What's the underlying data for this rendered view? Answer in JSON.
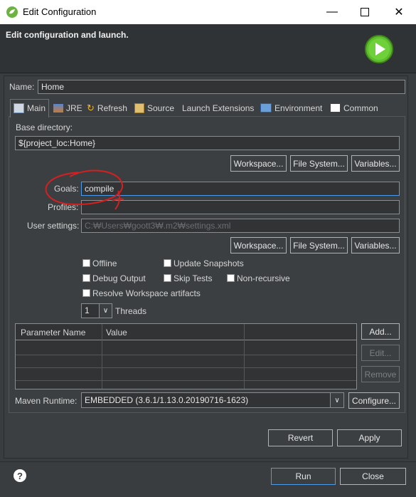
{
  "window": {
    "title": "Edit Configuration"
  },
  "header": {
    "title": "Edit configuration and launch."
  },
  "name": {
    "label": "Name:",
    "value": "Home"
  },
  "tabs": [
    {
      "label": "Main",
      "icon": "main-tab-icon"
    },
    {
      "label": "JRE",
      "icon": "jre-icon"
    },
    {
      "label": "Refresh",
      "icon": "refresh-icon"
    },
    {
      "label": "Source",
      "icon": "source-icon"
    },
    {
      "label": "Launch Extensions",
      "icon": ""
    },
    {
      "label": "Environment",
      "icon": "environment-icon"
    },
    {
      "label": "Common",
      "icon": "common-icon"
    }
  ],
  "base": {
    "label": "Base directory:",
    "value": "${project_loc:Home}"
  },
  "buttons1": {
    "workspace": "Workspace...",
    "filesystem": "File System...",
    "variables": "Variables..."
  },
  "goals": {
    "label": "Goals:",
    "value": "compile"
  },
  "profiles": {
    "label": "Profiles:",
    "value": ""
  },
  "user_settings": {
    "label": "User settings:",
    "value": "C:₩Users₩goott3₩.m2₩settings.xml"
  },
  "buttons2": {
    "workspace": "Workspace...",
    "filesystem": "File System...",
    "variables": "Variables..."
  },
  "options": {
    "offline": "Offline",
    "update_snapshots": "Update Snapshots",
    "debug_output": "Debug Output",
    "skip_tests": "Skip Tests",
    "non_recursive": "Non-recursive",
    "resolve_workspace": "Resolve Workspace artifacts"
  },
  "threads": {
    "value": "1",
    "label": "Threads"
  },
  "param_table": {
    "headers": [
      "Parameter Name",
      "Value",
      ""
    ]
  },
  "param_buttons": {
    "add": "Add...",
    "edit": "Edit...",
    "remove": "Remove"
  },
  "runtime": {
    "label": "Maven Runtime:",
    "value": "EMBEDDED (3.6.1/1.13.0.20190716-1623)",
    "configure": "Configure..."
  },
  "actions": {
    "revert": "Revert",
    "apply": "Apply"
  },
  "footer": {
    "help": "?",
    "run": "Run",
    "close": "Close"
  },
  "colors": {
    "accent": "#4d9be6",
    "annotation": "#d42020",
    "run_icon": "#5fbd2e"
  }
}
